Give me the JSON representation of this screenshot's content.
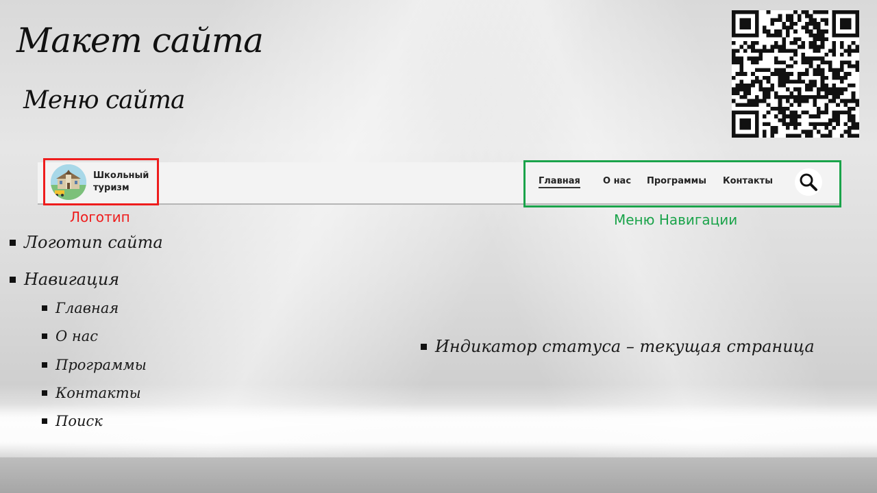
{
  "slide": {
    "title": "Макет сайта",
    "subtitle": "Меню сайта"
  },
  "mockup": {
    "logo_text_line1": "Школьный",
    "logo_text_line2": "туризм",
    "logo_caption": "Логотип",
    "nav_caption": "Меню Навигации",
    "nav_items": [
      {
        "label": "Главная",
        "active": true
      },
      {
        "label": "О нас",
        "active": false
      },
      {
        "label": "Программы",
        "active": false
      },
      {
        "label": "Контакты",
        "active": false
      }
    ],
    "search_icon": "search-icon"
  },
  "bullets": {
    "logo": "Логотип сайта",
    "navigation": "Навигация",
    "nav_sub": [
      "Главная",
      "О нас",
      "Программы",
      "Контакты",
      "Поиск"
    ],
    "status": "Индикатор статуса – текущая страница"
  },
  "colors": {
    "logo_highlight": "#ee1c1c",
    "nav_highlight": "#1aa34a"
  }
}
